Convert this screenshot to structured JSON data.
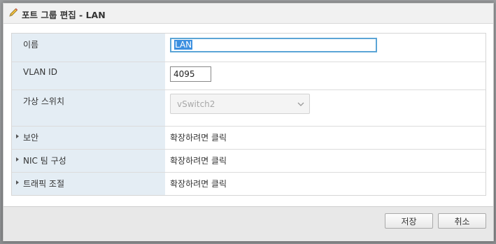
{
  "dialog": {
    "title": "포트 그룹 편집 - LAN",
    "icon": "pencil-icon"
  },
  "fields": {
    "name": {
      "label": "이름",
      "value": "LAN"
    },
    "vlan": {
      "label": "VLAN ID",
      "value": "4095"
    },
    "vswitch": {
      "label": "가상 스위치",
      "value": "vSwitch2"
    }
  },
  "sections": [
    {
      "label": "보안",
      "value": "확장하려면 클릭"
    },
    {
      "label": "NIC 팀 구성",
      "value": "확장하려면 클릭"
    },
    {
      "label": "트래픽 조절",
      "value": "확장하려면 클릭"
    }
  ],
  "footer": {
    "save_label": "저장",
    "cancel_label": "취소"
  },
  "colors": {
    "label_bg": "#e4edf4",
    "focus_border": "#5ba5d6",
    "selection": "#3b8fe0"
  }
}
